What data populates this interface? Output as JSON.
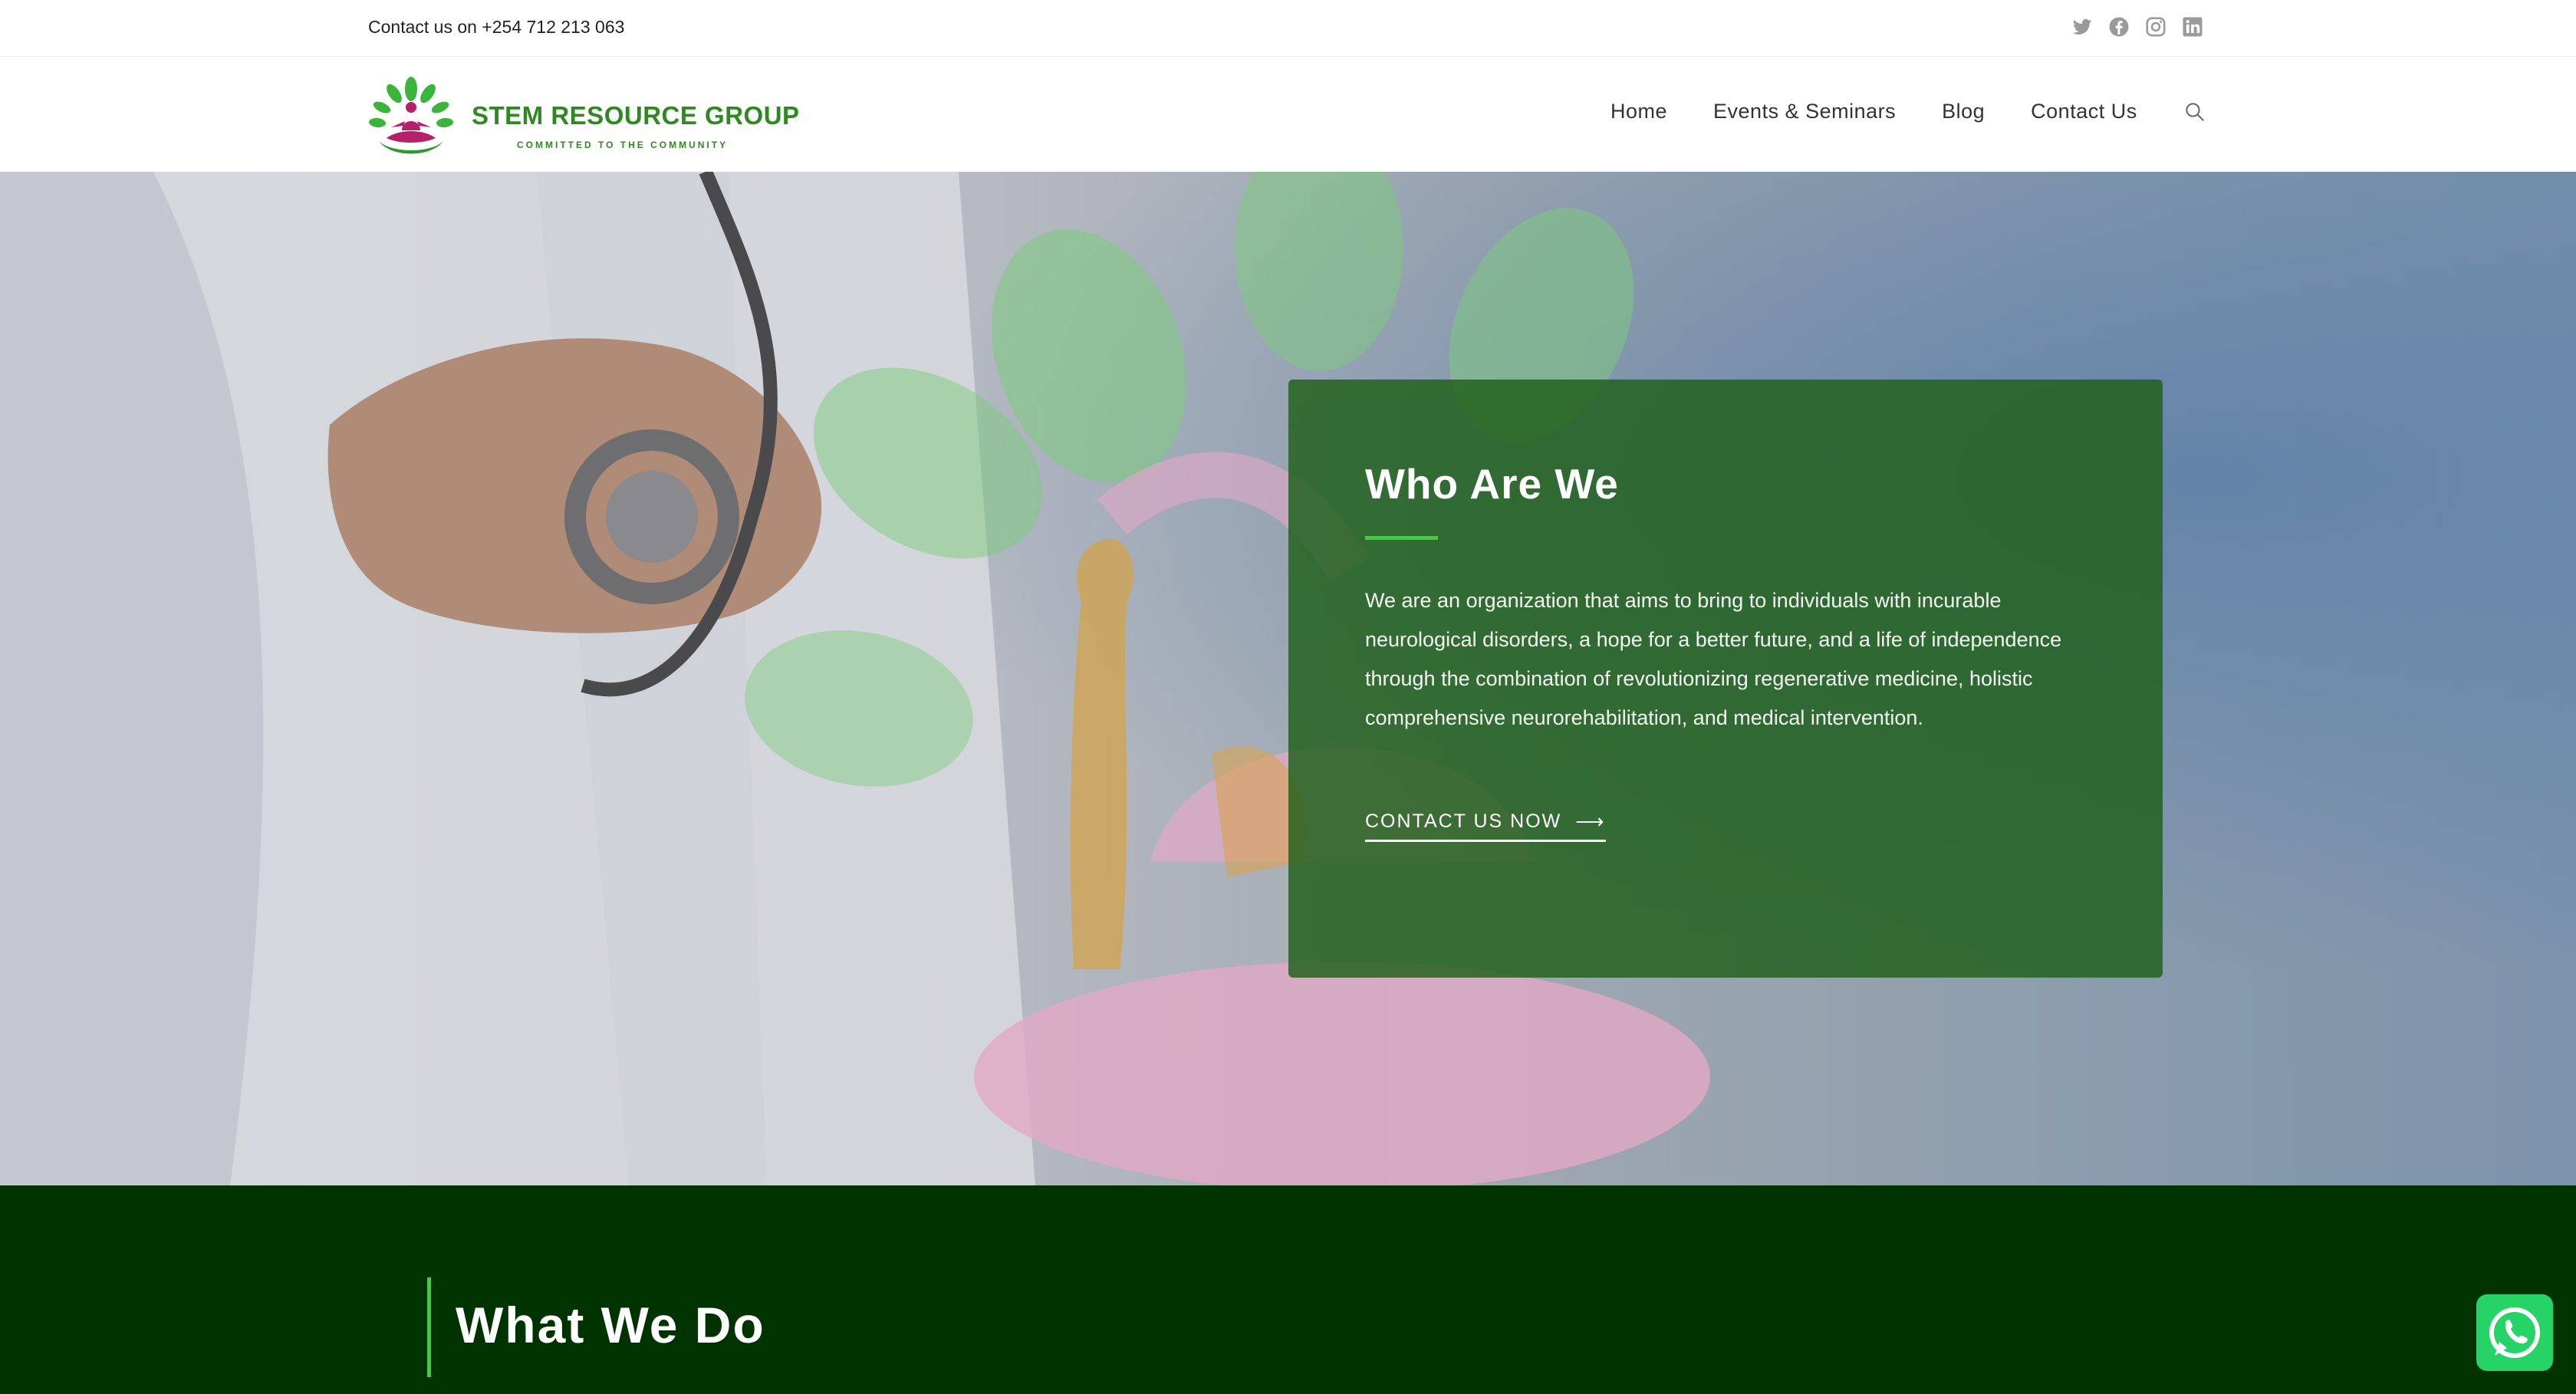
{
  "topbar": {
    "contact_text": "Contact us on +254 712 213 063",
    "social_icons": [
      "twitter-icon",
      "facebook-icon",
      "instagram-icon",
      "linkedin-icon"
    ]
  },
  "header": {
    "logo_name": "STEM RESOURCE GROUP",
    "logo_tagline": "COMMITTED TO THE COMMUNITY",
    "nav": [
      "Home",
      "Events & Seminars",
      "Blog",
      "Contact Us"
    ],
    "search_icon": "search-icon"
  },
  "hero": {
    "title": "Who Are We",
    "body": "We are an organization that aims to bring to individuals with incurable neurological disorders, a hope for a better future, and a life of independence through the combination of revolutionizing regenerative medicine, holistic comprehensive neurorehabilitation, and medical intervention.",
    "cta_label": "CONTACT US NOW",
    "cta_icon": "arrow-right-icon"
  },
  "section": {
    "title": "What We Do"
  },
  "whatsapp": {
    "icon": "whatsapp-icon"
  },
  "colors": {
    "brand_green": "#2e8a1f",
    "accent_green": "#3ad13a",
    "card_green": "#1e5f19",
    "dark_section": "#003300",
    "whatsapp": "#25d366"
  }
}
